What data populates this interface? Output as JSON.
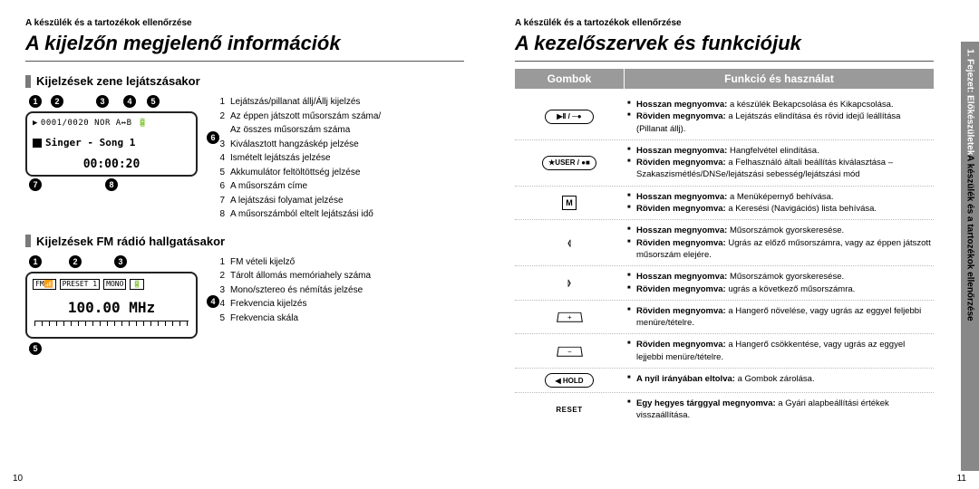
{
  "crumb": "A készülék és a tartozékok ellenőrzése",
  "left": {
    "title": "A kijelzőn megjelenő információk",
    "sec1": {
      "title": "Kijelzések zene lejátszásakor",
      "lcd": {
        "topbar": "0001/0020  NOR  A↔B  🔋",
        "song": "Singer - Song 1",
        "time": "00:00:20"
      },
      "legend": [
        "Lejátszás/pillanat állj/Állj kijelzés",
        "Az éppen játszott műsorszám száma/\nAz összes műsorszám száma",
        "Kiválasztott hangzáskép jelzése",
        "Ismételt lejátszás jelzése",
        "Akkumulátor feltöltöttség jelzése",
        "A műsorszám címe",
        "A lejátszási folyamat jelzése",
        "A műsorszámból eltelt lejátszási idő"
      ]
    },
    "sec2": {
      "title": "Kijelzések FM rádió hallgatásakor",
      "lcd": {
        "topbar_items": [
          "FM📶",
          "PRESET 1",
          "MONO",
          "🔋"
        ],
        "freq": "100.00 MHz"
      },
      "legend": [
        "FM vételi kijelző",
        "Tárolt állomás memóriahely száma",
        "Mono/sztereo és némítás jelzése",
        "Frekvencia kijelzés",
        "Frekvencia skála"
      ]
    },
    "pagenum": "10"
  },
  "right": {
    "title": "A kezelőszervek és funkciójuk",
    "table_head": {
      "c1": "Gombok",
      "c2": "Funkció és használat"
    },
    "rows": [
      {
        "btn": {
          "type": "pill",
          "label": "▶Ⅱ / ─●"
        },
        "lines": [
          {
            "b": "Hosszan megnyomva:",
            "t": " a készülék Bekapcsolása és Kikapcsolása."
          },
          {
            "b": "Röviden megnyomva:",
            "t": " a Lejátszás elindítása és rövid idejű leállítása (Pillanat állj)."
          }
        ]
      },
      {
        "btn": {
          "type": "pill",
          "label": "★USER / ●■"
        },
        "lines": [
          {
            "b": "Hosszan megnyomva:",
            "t": " Hangfelvétel elindítása."
          },
          {
            "b": "Röviden megnyomva:",
            "t": " a Felhasználó általi beállítás kiválasztása – Szakaszismétlés/DNSe/lejátszási sebesség/lejátszási mód"
          }
        ]
      },
      {
        "btn": {
          "type": "square",
          "label": "M"
        },
        "lines": [
          {
            "b": "Hosszan megnyomva:",
            "t": " a Menüképernyő behívása."
          },
          {
            "b": "Röviden megnyomva:",
            "t": " a Keresési (Navigációs) lista behívása."
          }
        ]
      },
      {
        "btn": {
          "type": "left",
          "label": ""
        },
        "lines": [
          {
            "b": "Hosszan megnyomva:",
            "t": " Műsorszámok gyorskeresése."
          },
          {
            "b": "Röviden megnyomva:",
            "t": " Ugrás az előző műsorszámra, vagy az éppen játszott műsorszám elejére."
          }
        ]
      },
      {
        "btn": {
          "type": "right",
          "label": ""
        },
        "lines": [
          {
            "b": "Hosszan megnyomva:",
            "t": " Műsorszámok gyorskeresése."
          },
          {
            "b": "Röviden megnyomva:",
            "t": " ugrás a következő műsorszámra."
          }
        ]
      },
      {
        "btn": {
          "type": "key",
          "label": "+"
        },
        "lines": [
          {
            "b": "Röviden megnyomva:",
            "t": " a Hangerő növelése, vagy ugrás az eggyel feljebbi menüre/tételre."
          }
        ]
      },
      {
        "btn": {
          "type": "key",
          "label": "−"
        },
        "lines": [
          {
            "b": "Röviden megnyomva:",
            "t": " a Hangerő csökkentése, vagy ugrás az eggyel lejjebbi menüre/tételre."
          }
        ]
      },
      {
        "btn": {
          "type": "pill",
          "label": "◀ HOLD"
        },
        "lines": [
          {
            "b": "A nyíl irányában eltolva:",
            "t": " a Gombok zárolása."
          }
        ]
      },
      {
        "btn": {
          "type": "reset",
          "label": "RESET"
        },
        "lines": [
          {
            "b": "Egy hegyes tárggyal megnyomva:",
            "t": " a Gyári alapbeállítási értékek visszaállítása."
          }
        ]
      }
    ],
    "sidebar": {
      "light": "1. Fejezet: Előkészületek",
      "dark": "  A készülék és a tartozékok ellenőrzése"
    },
    "pagenum": "11"
  }
}
